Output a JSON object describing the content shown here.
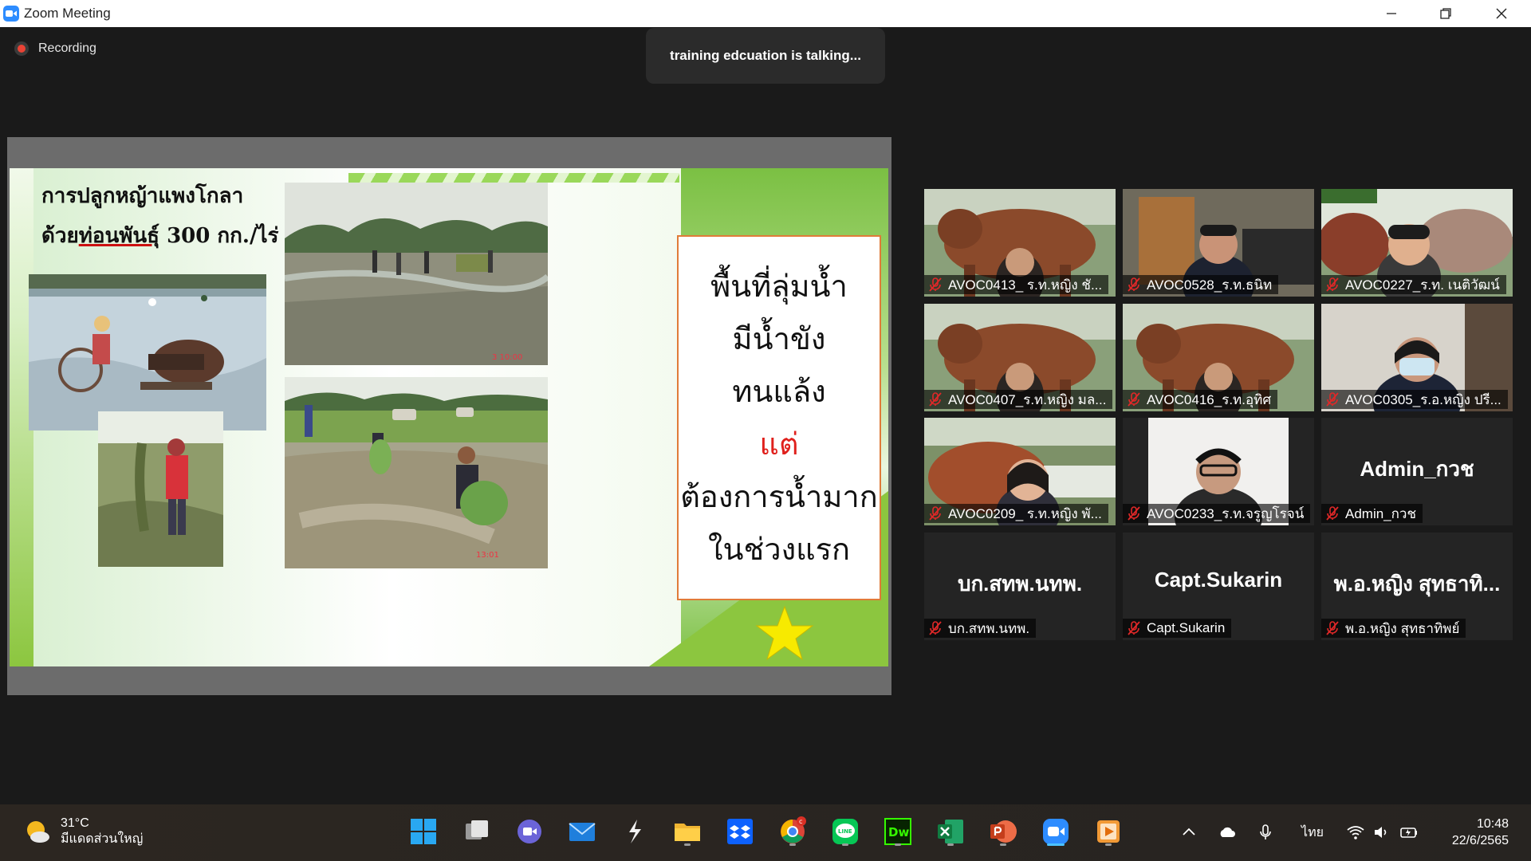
{
  "window": {
    "title": "Zoom Meeting"
  },
  "meeting": {
    "recording_label": "Recording",
    "speaker_banner": "training edcuation is talking..."
  },
  "slide": {
    "heading_line1": "การปลูกหญ้าแพงโกลา",
    "heading_line2_prefix": "ด้วย",
    "heading_line2_underlined": "ท่อนพันธุ์",
    "heading_line2_suffix": " 300 กก./ไร่",
    "photo_timestamp_1": "3 10:00",
    "photo_timestamp_2": "13:01",
    "box_lines": [
      "พื้นที่ลุ่มน้ำ",
      "มีน้ำขัง",
      "ทนแล้ง",
      "แต่",
      "ต้องการน้ำมาก",
      "ในช่วงแรก"
    ],
    "accent_red": "#e0211d",
    "star_color": "#f7ea00"
  },
  "participants": [
    {
      "name": "AVOC0413_ ร.ท.หญิง ชั...",
      "muted": true,
      "video": true,
      "bg": "cow"
    },
    {
      "name": "AVOC0528_ร.ท.ธนิท",
      "muted": true,
      "video": true,
      "bg": "room"
    },
    {
      "name": "AVOC0227_ร.ท. เนติวัฒน์",
      "muted": true,
      "video": true,
      "bg": "cow2"
    },
    {
      "name": "AVOC0407_ร.ท.หญิง มล...",
      "muted": true,
      "video": true,
      "bg": "cow"
    },
    {
      "name": "AVOC0416_ร.ท.อุทิศ",
      "muted": true,
      "video": true,
      "bg": "cow"
    },
    {
      "name": "AVOC0305_ร.อ.หญิง ปรี...",
      "muted": true,
      "video": true,
      "bg": "office"
    },
    {
      "name": "AVOC0209_ ร.ท.หญิง พั...",
      "muted": true,
      "video": true,
      "bg": "cow3"
    },
    {
      "name": "AVOC0233_ร.ท.จรูญโรจน์",
      "muted": true,
      "video": true,
      "bg": "white"
    },
    {
      "name": "Admin_กวช",
      "muted": true,
      "video": false,
      "display": "Admin_กวช"
    },
    {
      "name": "บก.สทพ.นทพ.",
      "muted": true,
      "video": false,
      "display": "บก.สทพ.นทพ."
    },
    {
      "name": "Capt.Sukarin",
      "muted": true,
      "video": false,
      "display": "Capt.Sukarin"
    },
    {
      "name": "พ.อ.หญิง สุทธาทิพย์",
      "muted": true,
      "video": false,
      "display": "พ.อ.หญิง สุทธาทิ..."
    }
  ],
  "taskbar": {
    "weather_temp": "31°C",
    "weather_condition": "มีแดดส่วนใหญ่",
    "language": "ไทย",
    "time": "10:48",
    "date": "22/6/2565",
    "apps": [
      "start-icon",
      "task-view-icon",
      "chat-icon",
      "mail-icon",
      "app-s-icon",
      "file-explorer-icon",
      "dropbox-icon",
      "chrome-icon",
      "line-icon",
      "dreamweaver-icon",
      "excel-icon",
      "powerpoint-icon",
      "zoom-icon",
      "media-player-icon"
    ],
    "dreamweaver_label": "Dw",
    "line_label": "LINE",
    "chrome_badge": "c"
  }
}
